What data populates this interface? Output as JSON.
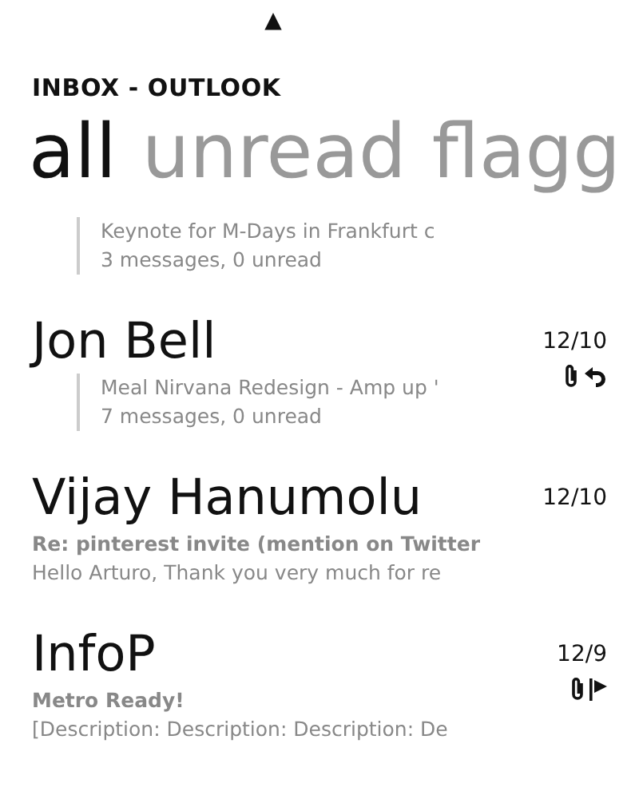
{
  "status_bar": {
    "signal": "▲"
  },
  "title": "INBOX - OUTLOOK",
  "pivots": [
    {
      "label": "all",
      "selected": true
    },
    {
      "label": "unread",
      "selected": false
    },
    {
      "label": "flagg",
      "selected": false
    }
  ],
  "messages": [
    {
      "kind": "thread",
      "subject": "Keynote for M-Days in Frankfurt c",
      "preview": "3 messages, 0 unread"
    },
    {
      "kind": "thread",
      "sender": "Jon Bell",
      "date": "12/10",
      "subject": "Meal Nirvana Redesign - Amp up '",
      "preview": "7 messages, 0 unread",
      "icons": [
        {
          "kind": "attachment"
        },
        {
          "kind": "reply"
        }
      ]
    },
    {
      "kind": "single",
      "sender": "Vijay Hanumolu",
      "date": "12/10",
      "subject": "Re: pinterest invite (mention on Twitter",
      "preview": "Hello Arturo, Thank you very much for re"
    },
    {
      "kind": "single",
      "sender": "InfoP",
      "date": "12/9",
      "subject": "Metro Ready!",
      "preview": "[Description: Description: Description: De",
      "icons": [
        {
          "kind": "attachment"
        },
        {
          "kind": "flag"
        }
      ]
    }
  ]
}
